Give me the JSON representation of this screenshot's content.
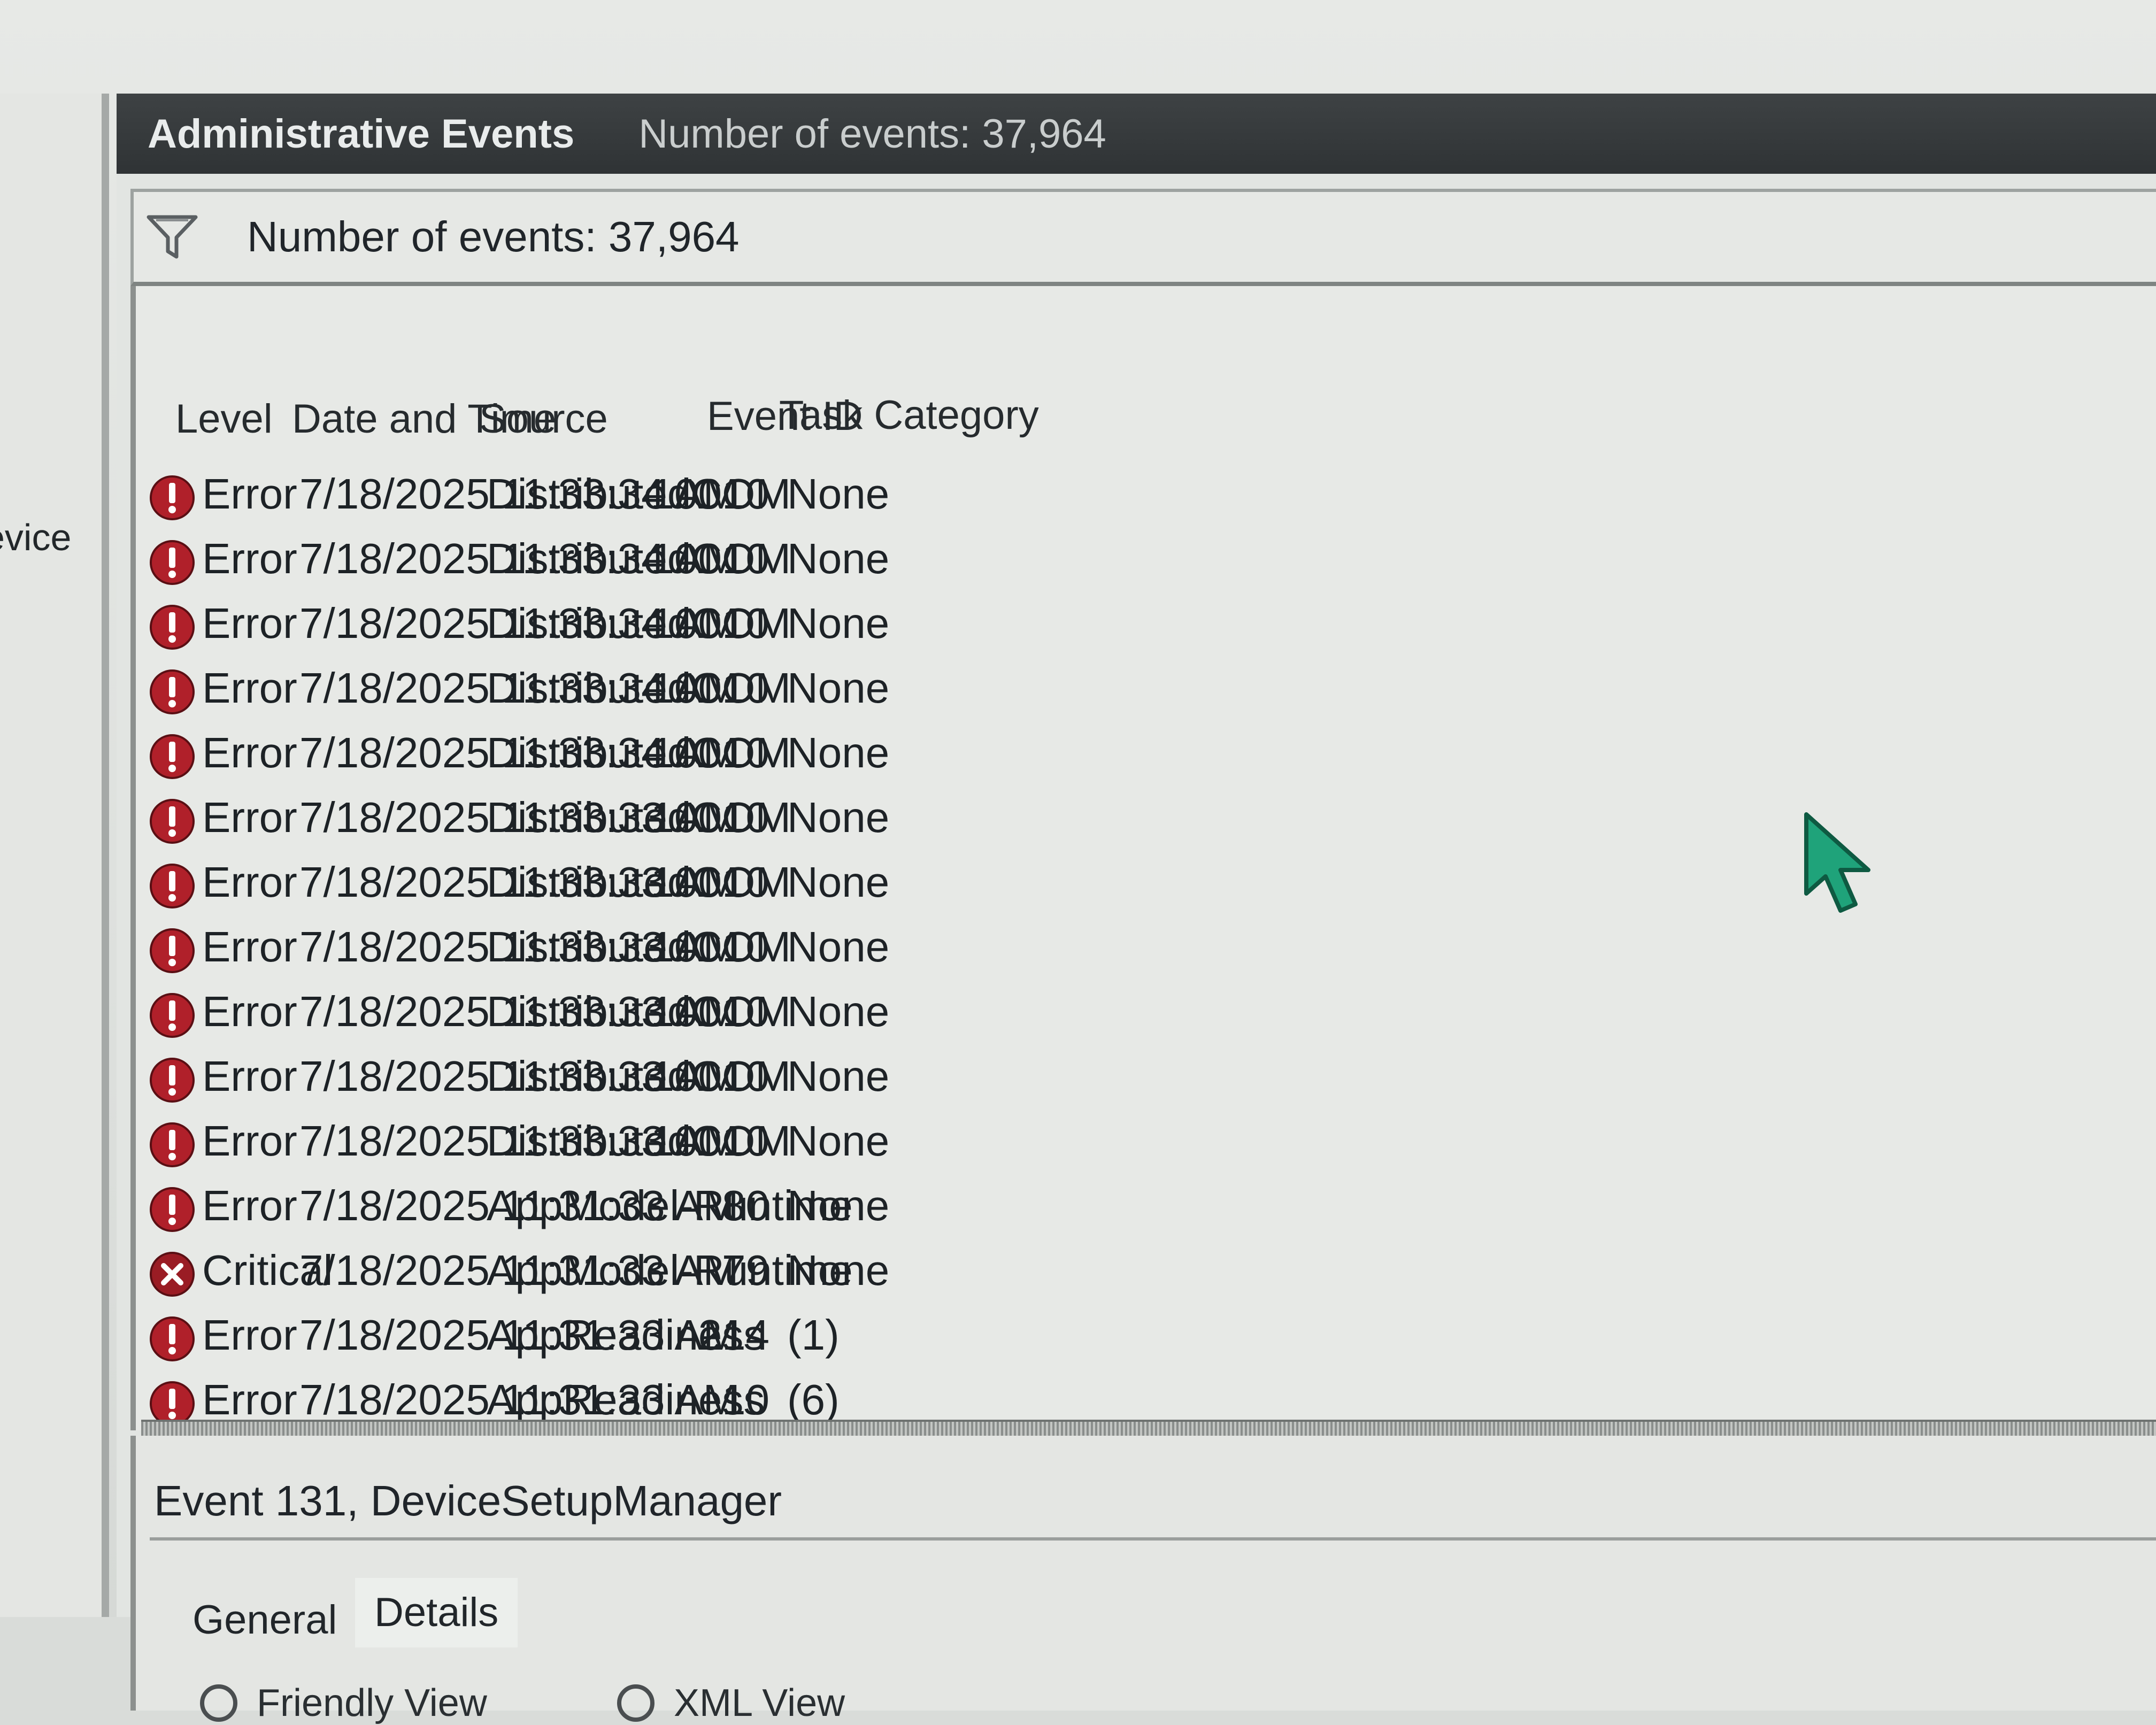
{
  "left_pane": {
    "partial_label": "evice"
  },
  "header": {
    "title": "Administrative Events",
    "count_text": "Number of events: 37,964"
  },
  "filter": {
    "icon": "filter-funnel-icon",
    "count_text": "Number of events: 37,964"
  },
  "table": {
    "columns": [
      "Level",
      "Date and Time",
      "Source",
      "Event ID",
      "Task Category"
    ],
    "rows": [
      {
        "level": "Error",
        "icon": "error-icon",
        "datetime": "7/18/2025 11:33:34 AM",
        "source": "DistributedCOM",
        "event_id": "10010",
        "task": "None"
      },
      {
        "level": "Error",
        "icon": "error-icon",
        "datetime": "7/18/2025 11:33:34 AM",
        "source": "DistributedCOM",
        "event_id": "10010",
        "task": "None"
      },
      {
        "level": "Error",
        "icon": "error-icon",
        "datetime": "7/18/2025 11:33:34 AM",
        "source": "DistributedCOM",
        "event_id": "10010",
        "task": "None"
      },
      {
        "level": "Error",
        "icon": "error-icon",
        "datetime": "7/18/2025 11:33:34 AM",
        "source": "DistributedCOM",
        "event_id": "10010",
        "task": "None"
      },
      {
        "level": "Error",
        "icon": "error-icon",
        "datetime": "7/18/2025 11:33:34 AM",
        "source": "DistributedCOM",
        "event_id": "10010",
        "task": "None"
      },
      {
        "level": "Error",
        "icon": "error-icon",
        "datetime": "7/18/2025 11:33:33 AM",
        "source": "DistributedCOM",
        "event_id": "10010",
        "task": "None"
      },
      {
        "level": "Error",
        "icon": "error-icon",
        "datetime": "7/18/2025 11:33:33 AM",
        "source": "DistributedCOM",
        "event_id": "10010",
        "task": "None"
      },
      {
        "level": "Error",
        "icon": "error-icon",
        "datetime": "7/18/2025 11:33:33 AM",
        "source": "DistributedCOM",
        "event_id": "10010",
        "task": "None"
      },
      {
        "level": "Error",
        "icon": "error-icon",
        "datetime": "7/18/2025 11:33:33 AM",
        "source": "DistributedCOM",
        "event_id": "10010",
        "task": "None"
      },
      {
        "level": "Error",
        "icon": "error-icon",
        "datetime": "7/18/2025 11:33:33 AM",
        "source": "DistributedCOM",
        "event_id": "10010",
        "task": "None"
      },
      {
        "level": "Error",
        "icon": "error-icon",
        "datetime": "7/18/2025 11:33:33 AM",
        "source": "DistributedCOM",
        "event_id": "10010",
        "task": "None"
      },
      {
        "level": "Error",
        "icon": "error-icon",
        "datetime": "7/18/2025 11:31:33 AM",
        "source": "AppModel-Runtime",
        "event_id": "80",
        "task": "None"
      },
      {
        "level": "Critical",
        "icon": "critical-icon",
        "datetime": "7/18/2025 11:31:33 AM",
        "source": "AppModel-Runtime",
        "event_id": "79",
        "task": "None"
      },
      {
        "level": "Error",
        "icon": "error-icon",
        "datetime": "7/18/2025 11:31:33 AM",
        "source": "AppReadiness",
        "event_id": "214",
        "task": "(1)"
      },
      {
        "level": "Error",
        "icon": "error-icon",
        "datetime": "7/18/2025 11:31:33 AM",
        "source": "AppReadiness",
        "event_id": "10",
        "task": "(6)"
      }
    ]
  },
  "detail": {
    "title": "Event 131, DeviceSetupManager",
    "tabs": [
      "General",
      "Details"
    ],
    "active_tab": "Details",
    "view_options": [
      "Friendly View",
      "XML View"
    ]
  },
  "colors": {
    "titlebar": "#2f3335",
    "error_icon": "#b0202a",
    "critical_icon": "#9a1c24",
    "cursor": "#1fa37a"
  }
}
